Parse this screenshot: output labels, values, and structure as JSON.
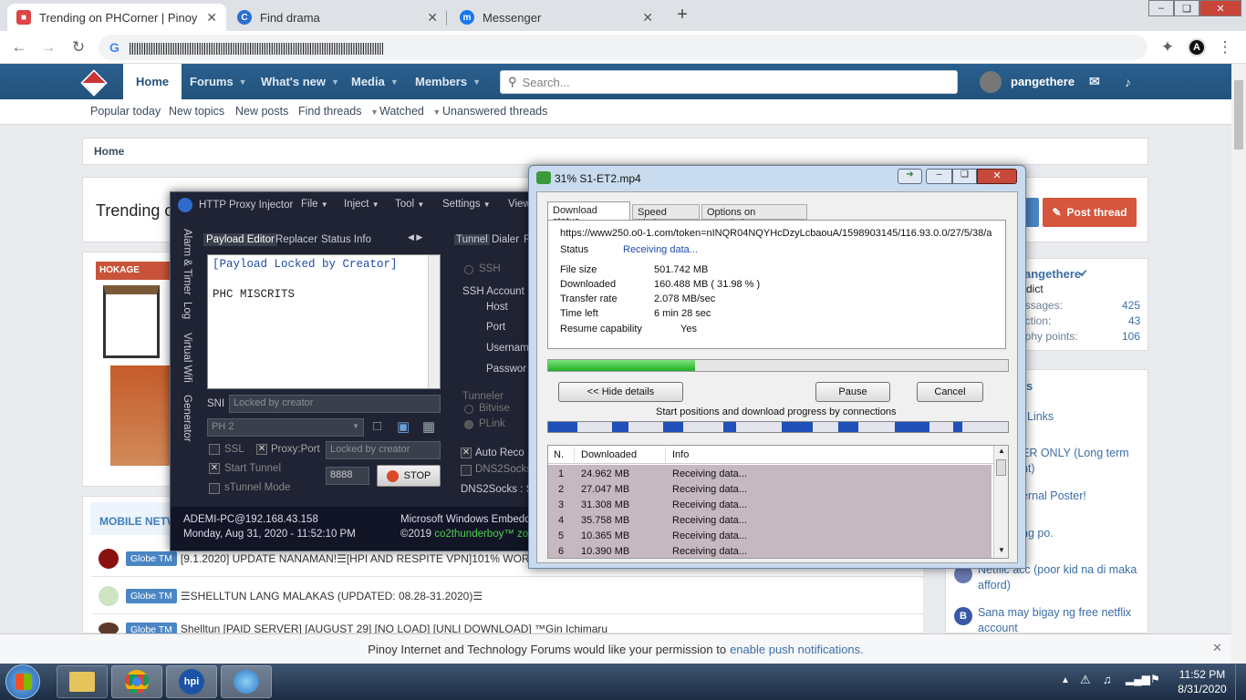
{
  "browser": {
    "tabs": [
      {
        "title": "Trending on PHCorner | Pinoy Int",
        "active": true
      },
      {
        "title": "Find drama",
        "active": false
      },
      {
        "title": "Messenger",
        "active": false
      }
    ],
    "new_tab": "+",
    "address": "||||||||||||||||||||||||||||||||||||||||||||||||||||||||||||||||||||||||||||||||||||||||||||||||||||||||||",
    "profile_initial": "A"
  },
  "site": {
    "nav": [
      {
        "label": "Home"
      },
      {
        "label": "Forums"
      },
      {
        "label": "What's new"
      },
      {
        "label": "Media"
      },
      {
        "label": "Members"
      }
    ],
    "search_placeholder": "Search...",
    "username": "pangethere",
    "subnav": [
      "Popular today",
      "New topics",
      "New posts",
      "Find threads",
      "Watched",
      "Unanswered threads"
    ],
    "breadcrumb": "Home",
    "page_title": "Trending o",
    "post_thread": "Post thread",
    "ad_brand": "HOKAGE",
    "section_title": "MOBILE NETW",
    "threads": [
      {
        "tag": "Globe TM",
        "title": "[9.1.2020] UPDATE NANAMAN!☰[HPI AND RESPITE VPN]101% WORK"
      },
      {
        "tag": "Globe TM",
        "title": "☰SHELLTUN LANG MALAKAS (UPDATED: 08.28-31.2020)☰"
      },
      {
        "tag": "Globe TM",
        "title": "Shelltun [PAID SERVER] [AUGUST 29] [NO LOAD] [UNLI DOWNLOAD] ™Gin Ichimaru"
      }
    ],
    "profile": {
      "name": "angethere",
      "role": "dict",
      "stats": [
        {
          "label": "essages:",
          "value": "425"
        },
        {
          "label": "action:",
          "value": "43"
        },
        {
          "label": "ophy points:",
          "value": "106"
        }
      ]
    },
    "sidebar_head": "s",
    "sidebar_items": [
      "Links",
      "ER ONLY (Long term",
      "nt)",
      "ernal Poster!",
      "ng po.",
      "Netflic acc (poor kid na di maka",
      "afford)",
      "Sana may bigay ng free netflix",
      "account"
    ],
    "notification": {
      "text": "Pinoy Internet and Technology Forums would like your permission to ",
      "link": "enable push notifications."
    }
  },
  "hpi": {
    "title": "HTTP Proxy Injector",
    "menu": [
      "File",
      "Inject",
      "Tool",
      "Settings",
      "View"
    ],
    "side_tabs": [
      "Alarm & Timer",
      "Log",
      "Virtual Wifi",
      "Generator"
    ],
    "tabs": [
      "Payload Editor",
      "Replacer",
      "Status Info"
    ],
    "tabs_right": [
      "Tunnel",
      "Dialer",
      "R"
    ],
    "payload_line1": "[Payload Locked by Creator]",
    "payload_line2": "PHC MISCRITS",
    "sni_label": "SNI",
    "sni_value": "Locked by creator",
    "profile_select": "PH 2",
    "ssl": "SSL",
    "proxy_port": "Proxy:Port",
    "proxy_value": "Locked by creator",
    "start_tunnel": "Start Tunnel",
    "port": "8888",
    "stop": "STOP",
    "stunnel": "sTunnel Mode",
    "ssh": "SSH",
    "ssh_account": "SSH Account",
    "host": "Host",
    "portlbl": "Port",
    "username": "Usernam",
    "password": "Passwor",
    "tunneler": "Tunneler",
    "bitvise": "Bitvise",
    "plink": "PLink",
    "auto_reco": "Auto Reco",
    "dns2socks": "DNS2Socks",
    "dns2socks_status": "DNS2Socks : St",
    "footer_left1": "ADEMI-PC@192.168.43.158",
    "footer_left2": "Monday, Aug 31, 2020 - 11:52:10 PM",
    "footer_right1": "Microsoft Windows Embedde",
    "footer_copy": "©2019 ",
    "footer_author": "co2thunderboy™ zor"
  },
  "idm": {
    "title": "31% S1-ET2.mp4",
    "tabs": [
      "Download status",
      "Speed Limiter",
      "Options on completion"
    ],
    "url": "https://www250.o0-1.com/token=nINQR04NQYHcDzyLcbaouA/1598903145/116.93.0.0/27/5/38/a",
    "status_label": "Status",
    "status_value": "Receiving data...",
    "fields": [
      {
        "label": "File size",
        "value": "501.742  MB"
      },
      {
        "label": "Downloaded",
        "value": "160.488  MB  ( 31.98 % )"
      },
      {
        "label": "Transfer rate",
        "value": "2.078  MB/sec"
      },
      {
        "label": "Time left",
        "value": "6 min 28 sec"
      },
      {
        "label": "Resume capability",
        "value": "Yes"
      }
    ],
    "progress": 0.3198,
    "hide_details": "<< Hide details",
    "pause": "Pause",
    "cancel": "Cancel",
    "connections_label": "Start positions and download progress by connections",
    "columns": [
      "N.",
      "Downloaded",
      "Info"
    ],
    "rows": [
      {
        "n": "1",
        "size": "24.962  MB",
        "info": "Receiving data..."
      },
      {
        "n": "2",
        "size": "27.047  MB",
        "info": "Receiving data..."
      },
      {
        "n": "3",
        "size": "31.308  MB",
        "info": "Receiving data..."
      },
      {
        "n": "4",
        "size": "35.758  MB",
        "info": "Receiving data..."
      },
      {
        "n": "5",
        "size": "10.365  MB",
        "info": "Receiving data..."
      },
      {
        "n": "6",
        "size": "10.390  MB",
        "info": "Receiving data..."
      }
    ]
  },
  "taskbar": {
    "time": "11:52 PM",
    "date": "8/31/2020",
    "hpi_icon": "hpi"
  }
}
